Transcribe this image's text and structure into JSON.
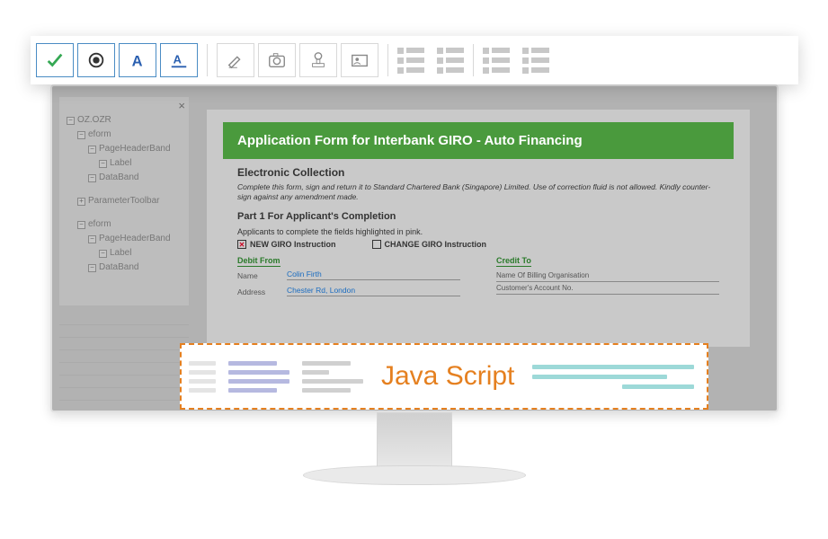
{
  "toolbar": {
    "icons": [
      "checkmark",
      "radio",
      "text-a",
      "text-a-underline",
      "signature",
      "camera",
      "stamp",
      "id-card",
      "list1",
      "list2",
      "list3",
      "list4"
    ]
  },
  "tree": {
    "root": "OZ.OZR",
    "groups": [
      {
        "name": "eform",
        "children": [
          {
            "name": "PageHeaderBand",
            "children": [
              {
                "name": "Label"
              }
            ]
          },
          {
            "name": "DataBand"
          }
        ]
      },
      {
        "name": "ParameterToolbar",
        "collapsed": true
      },
      {
        "name": "eform",
        "children": [
          {
            "name": "PageHeaderBand",
            "children": [
              {
                "name": "Label"
              }
            ]
          },
          {
            "name": "DataBand"
          }
        ]
      }
    ]
  },
  "form": {
    "title": "Application Form for Interbank GIRO - Auto Financing",
    "section1_title": "Electronic Collection",
    "section1_note": "Complete this form, sign and return it to Standard Chartered Bank (Singapore) Limited. Use of correction fluid is not allowed. Kindly counter-sign against any amendment made.",
    "part_title": "Part 1 For Applicant's Completion",
    "hint": "Applicants to complete the fields highlighted in pink.",
    "check_new": "NEW GIRO Instruction",
    "check_change": "CHANGE GIRO Instruction",
    "debit_head": "Debit From",
    "credit_head": "Credit To",
    "name_label": "Name",
    "name_value": "Colin Firth",
    "addr_label": "Address",
    "addr_value": "Chester Rd, London",
    "credit_r1": "Name Of Billing Organisation",
    "credit_r2": "Customer's Account No."
  },
  "panel": {
    "js_label": "Java Script"
  }
}
